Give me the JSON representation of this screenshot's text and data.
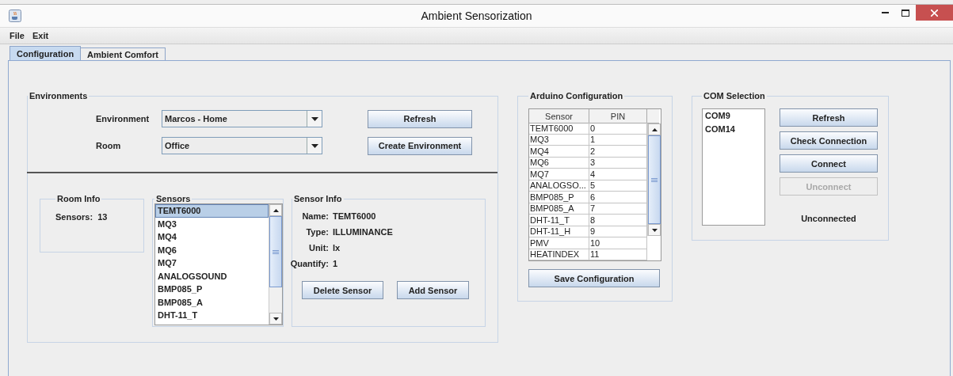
{
  "window": {
    "title": "Ambient Sensorization"
  },
  "menu": [
    "File",
    "Exit"
  ],
  "tabs": [
    {
      "label": "Configuration",
      "selected": true
    },
    {
      "label": "Ambient Comfort",
      "selected": false
    }
  ],
  "environments": {
    "title": "Environments",
    "fields": [
      {
        "label": "Environment",
        "value": "Marcos - Home"
      },
      {
        "label": "Room",
        "value": "Office"
      }
    ],
    "buttons": [
      "Refresh",
      "Create Environment"
    ]
  },
  "room_info": {
    "title": "Room Info",
    "label": "Sensors:",
    "value": "13"
  },
  "sensors": {
    "title": "Sensors",
    "items": [
      {
        "label": "TEMT6000",
        "selected": true
      },
      {
        "label": "MQ3",
        "selected": false
      },
      {
        "label": "MQ4",
        "selected": false
      },
      {
        "label": "MQ6",
        "selected": false
      },
      {
        "label": "MQ7",
        "selected": false
      },
      {
        "label": "ANALOGSOUND",
        "selected": false
      },
      {
        "label": "BMP085_P",
        "selected": false
      },
      {
        "label": "BMP085_A",
        "selected": false
      },
      {
        "label": "DHT-11_T",
        "selected": false
      }
    ]
  },
  "sensor_info": {
    "title": "Sensor Info",
    "fields": [
      {
        "label": "Name:",
        "value": "TEMT6000"
      },
      {
        "label": "Type:",
        "value": "ILLUMINANCE"
      },
      {
        "label": "Unit:",
        "value": "lx"
      },
      {
        "label": "Quantify:",
        "value": "1"
      }
    ],
    "buttons": [
      "Delete Sensor",
      "Add Sensor"
    ]
  },
  "arduino": {
    "title": "Arduino Configuration",
    "columns": [
      "Sensor",
      "PIN"
    ],
    "rows": [
      [
        "TEMT6000",
        "0"
      ],
      [
        "MQ3",
        "1"
      ],
      [
        "MQ4",
        "2"
      ],
      [
        "MQ6",
        "3"
      ],
      [
        "MQ7",
        "4"
      ],
      [
        "ANALOGSO...",
        "5"
      ],
      [
        "BMP085_P",
        "6"
      ],
      [
        "BMP085_A",
        "7"
      ],
      [
        "DHT-11_T",
        "8"
      ],
      [
        "DHT-11_H",
        "9"
      ],
      [
        "PMV",
        "10"
      ],
      [
        "HEATINDEX",
        "11"
      ]
    ],
    "button": "Save Configuration"
  },
  "com": {
    "title": "COM Selection",
    "ports": [
      {
        "label": "COM9",
        "selected": false
      },
      {
        "label": "COM14",
        "selected": false
      }
    ],
    "buttons": [
      {
        "label": "Refresh",
        "disabled": false
      },
      {
        "label": "Check Connection",
        "disabled": false
      },
      {
        "label": "Connect",
        "disabled": false
      },
      {
        "label": "Unconnect",
        "disabled": true
      }
    ],
    "status": "Unconnected"
  }
}
